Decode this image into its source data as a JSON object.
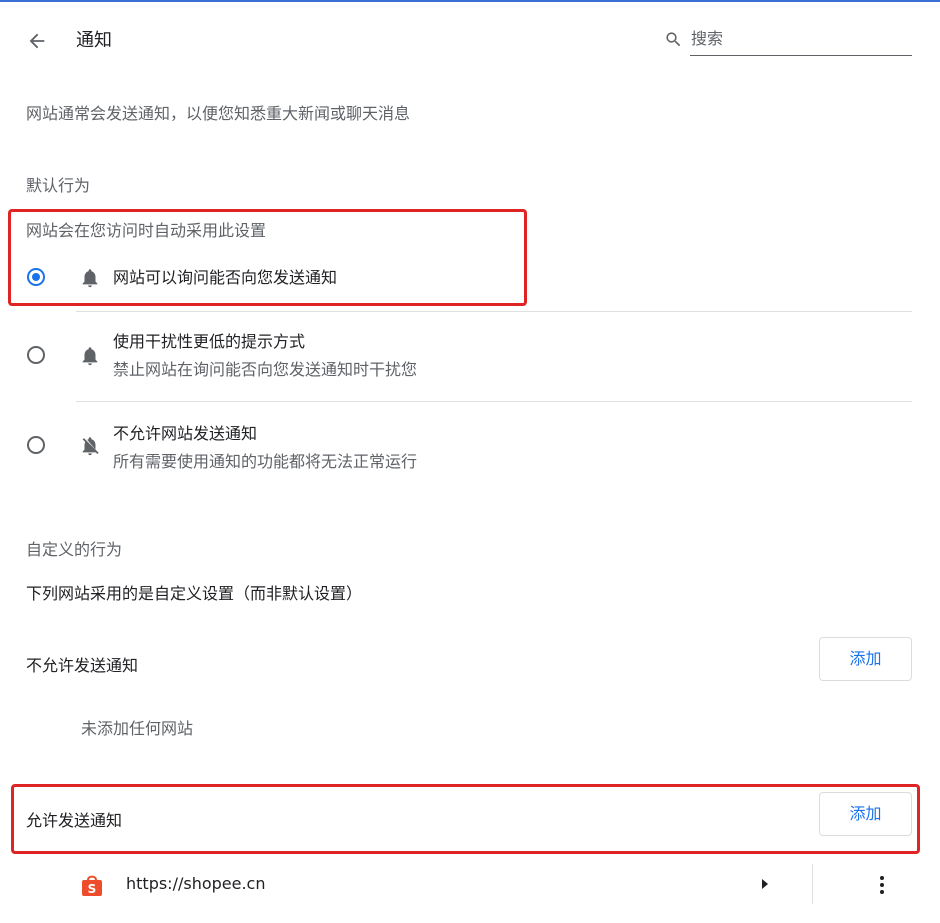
{
  "header": {
    "back_icon": "arrow-back-icon",
    "title": "通知",
    "search_icon": "search-icon",
    "search_placeholder": "搜索"
  },
  "description": "网站通常会发送通知，以便您知悉重大新闻或聊天消息",
  "default_behavior": {
    "heading": "默认行为",
    "subheading": "网站会在您访问时自动采用此设置",
    "options": [
      {
        "label": "网站可以询问能否向您发送通知",
        "sublabel": "",
        "icon": "bell-icon",
        "checked": true
      },
      {
        "label": "使用干扰性更低的提示方式",
        "sublabel": "禁止网站在询问能否向您发送通知时干扰您",
        "icon": "bell-icon",
        "checked": false
      },
      {
        "label": "不允许网站发送通知",
        "sublabel": "所有需要使用通知的功能都将无法正常运行",
        "icon": "bell-off-icon",
        "checked": false
      }
    ]
  },
  "custom_behavior": {
    "heading": "自定义的行为",
    "subheading": "下列网站采用的是自定义设置（而非默认设置）",
    "block": {
      "label": "不允许发送通知",
      "add_label": "添加",
      "empty_text": "未添加任何网站"
    },
    "allow": {
      "label": "允许发送通知",
      "add_label": "添加",
      "sites": [
        {
          "url": "https://shopee.cn",
          "icon": "shopee-icon"
        }
      ]
    }
  },
  "colors": {
    "accent": "#1a73e8",
    "highlight_box": "#e02424",
    "shopee": "#ee4d2d"
  }
}
